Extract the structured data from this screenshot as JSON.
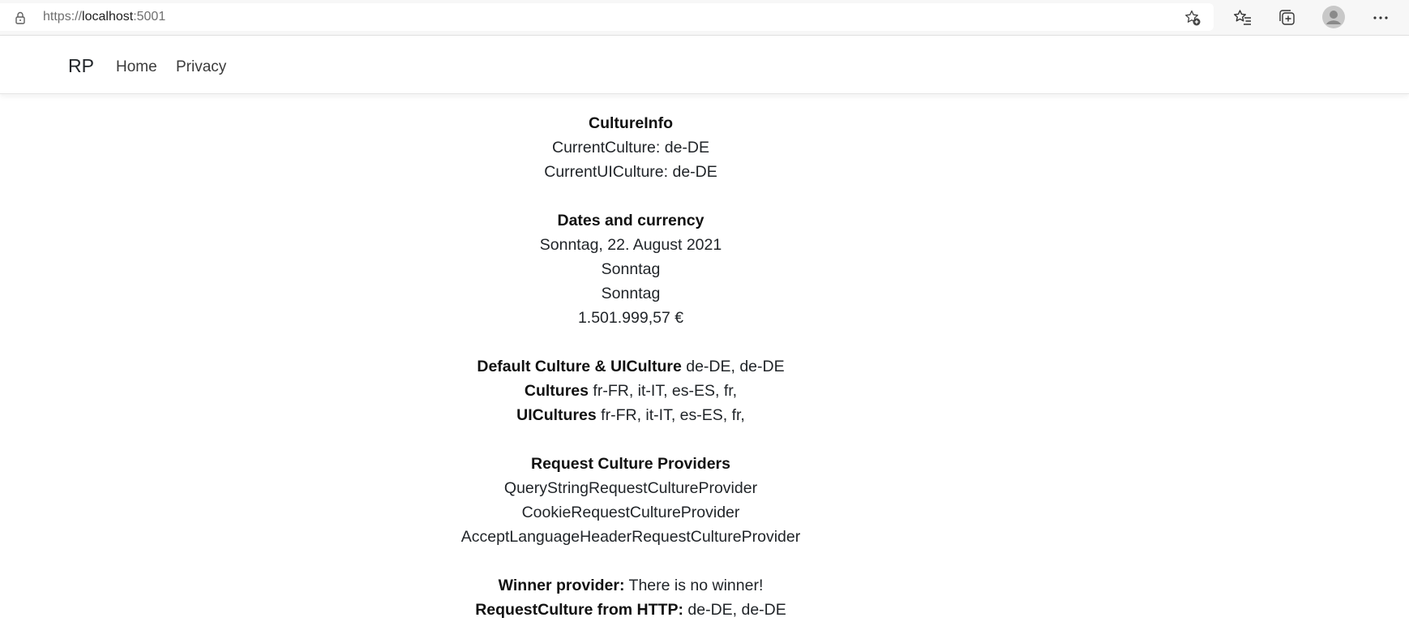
{
  "browser": {
    "url_scheme": "https://",
    "url_host": "localhost",
    "url_port": ":5001",
    "icons": [
      "lock-icon",
      "add-favorite-icon",
      "favorites-icon",
      "collections-icon",
      "profile-avatar-icon",
      "more-icon"
    ]
  },
  "navbar": {
    "brand": "RP",
    "links": [
      "Home",
      "Privacy"
    ]
  },
  "culture_info": {
    "heading": "CultureInfo",
    "current_culture": "CurrentCulture: de-DE",
    "current_ui_culture": "CurrentUICulture: de-DE"
  },
  "dates_currency": {
    "heading": "Dates and currency",
    "long_date": "Sonntag, 22. August 2021",
    "day_name_1": "Sonntag",
    "day_name_2": "Sonntag",
    "currency": "1.501.999,57 €"
  },
  "defaults": {
    "default_label": "Default Culture & UICulture",
    "default_value": " de-DE, de-DE",
    "cultures_label": "Cultures",
    "cultures_value": " fr-FR, it-IT, es-ES, fr,",
    "uicultures_label": "UICultures",
    "uicultures_value": " fr-FR, it-IT, es-ES, fr,"
  },
  "providers": {
    "heading": "Request Culture Providers",
    "items": [
      "QueryStringRequestCultureProvider",
      "CookieRequestCultureProvider",
      "AcceptLanguageHeaderRequestCultureProvider"
    ]
  },
  "winner": {
    "winner_label": "Winner provider:",
    "winner_value": " There is no winner!",
    "request_label": "RequestCulture from HTTP:",
    "request_value": " de-DE, de-DE"
  }
}
